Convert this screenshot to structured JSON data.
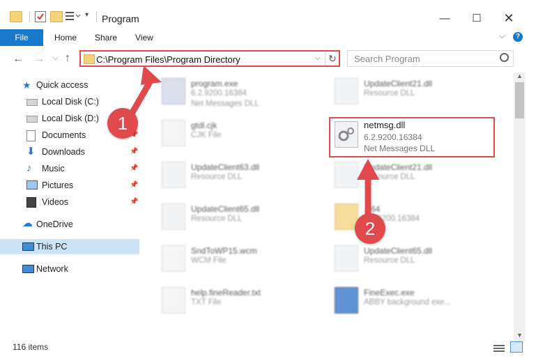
{
  "window": {
    "title": "Program"
  },
  "ribbon": {
    "tabs": [
      "File",
      "Home",
      "Share",
      "View"
    ]
  },
  "address": {
    "path": "C:\\Program Files\\Program Directory"
  },
  "search": {
    "placeholder": "Search Program"
  },
  "sidebar": {
    "items": [
      {
        "label": "Quick access"
      },
      {
        "label": "Local Disk (C:)"
      },
      {
        "label": "Local Disk (D:)"
      },
      {
        "label": "Documents"
      },
      {
        "label": "Downloads"
      },
      {
        "label": "Music"
      },
      {
        "label": "Pictures"
      },
      {
        "label": "Videos"
      },
      {
        "label": "OneDrive"
      },
      {
        "label": "This PC"
      },
      {
        "label": "Network"
      }
    ]
  },
  "files": [
    {
      "name": "program.exe",
      "l2": "6.2.9200.16384",
      "l3": "Net Messages DLL"
    },
    {
      "name": "UpdateClient21.dll",
      "l2": "Resource DLL"
    },
    {
      "name": "gtdl.cjk",
      "l2": "CJK File"
    },
    {
      "name": "netmsg.dll",
      "l2": "6.2.9200.16384",
      "l3": "Net Messages DLL"
    },
    {
      "name": "UpdateClient63.dll",
      "l2": "Resource DLL"
    },
    {
      "name": "UpdateClient21.dll",
      "l2": "Resource DLL"
    },
    {
      "name": "UpdateClient65.dll",
      "l2": "Resource DLL"
    },
    {
      "name": "...64",
      "l2": "6.2.9200.16384"
    },
    {
      "name": "SndToWP15.wcm",
      "l2": "WCM File"
    },
    {
      "name": "UpdateClient65.dll",
      "l2": "Resource DLL"
    },
    {
      "name": "help.fineReader.txt",
      "l2": "TXT File"
    },
    {
      "name": "FineExec.exe",
      "l2": "ABBY background exe..."
    }
  ],
  "status": {
    "count": "116 items"
  },
  "annotations": {
    "one": "1",
    "two": "2"
  },
  "colors": {
    "accent": "#1979ca",
    "highlight": "#e04a4e"
  }
}
